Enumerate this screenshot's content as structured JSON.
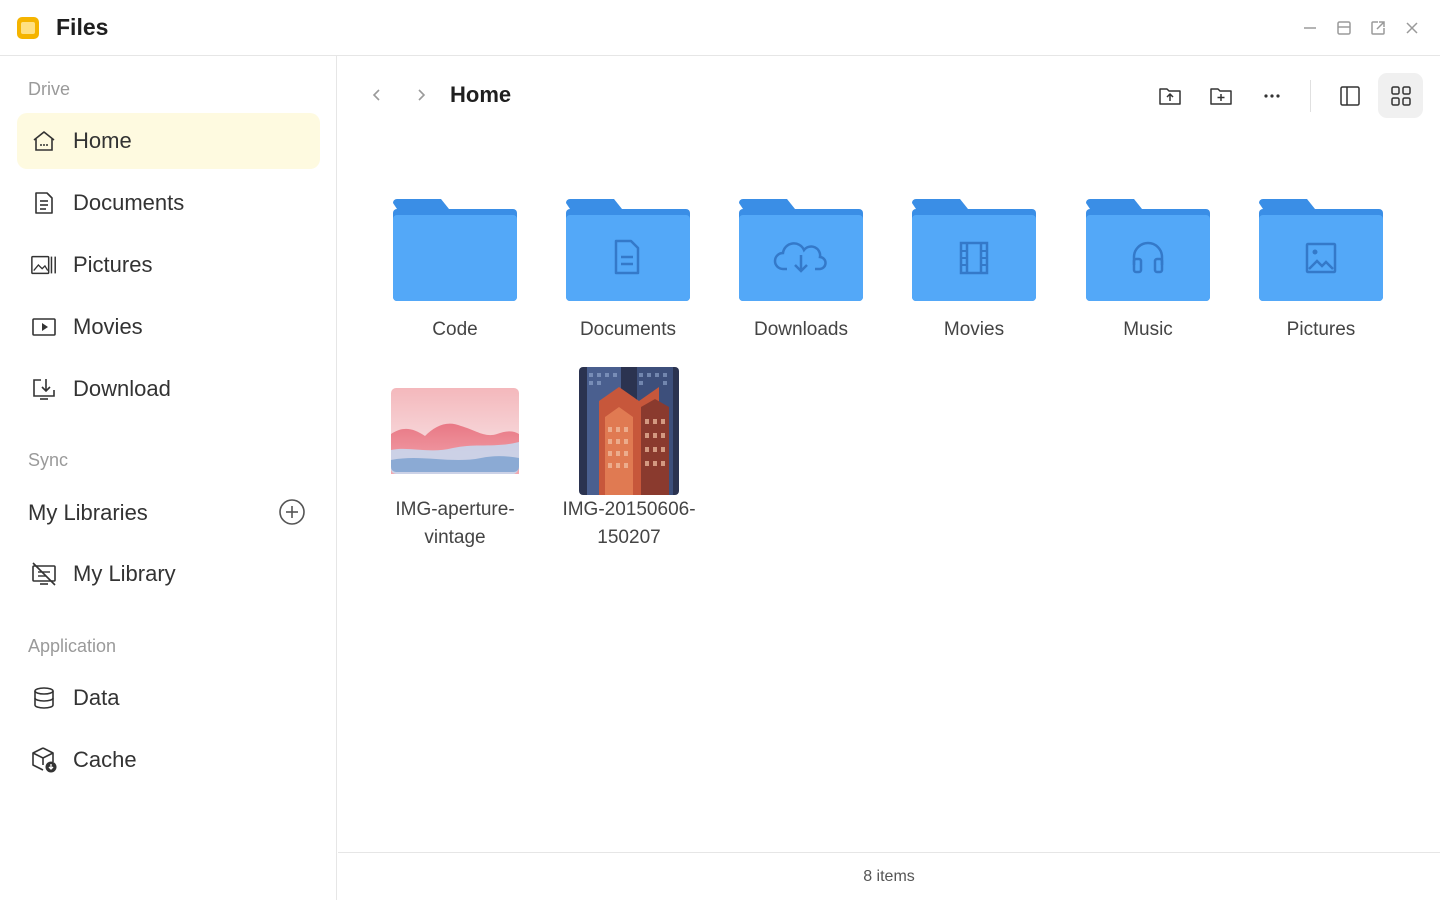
{
  "app": {
    "title": "Files"
  },
  "sidebar": {
    "sections": {
      "drive": "Drive",
      "sync": "Sync",
      "application": "Application"
    },
    "drive_items": [
      {
        "label": "Home",
        "icon": "home-icon",
        "active": true
      },
      {
        "label": "Documents",
        "icon": "document-icon"
      },
      {
        "label": "Pictures",
        "icon": "pictures-icon"
      },
      {
        "label": "Movies",
        "icon": "movie-icon"
      },
      {
        "label": "Download",
        "icon": "download-icon"
      }
    ],
    "sync": {
      "header": "My Libraries",
      "items": [
        {
          "label": "My Library",
          "icon": "library-icon"
        }
      ]
    },
    "application_items": [
      {
        "label": "Data",
        "icon": "database-icon"
      },
      {
        "label": "Cache",
        "icon": "cache-icon"
      }
    ]
  },
  "toolbar": {
    "breadcrumb": "Home"
  },
  "items": [
    {
      "name": "Code",
      "kind": "folder",
      "glyph": "none"
    },
    {
      "name": "Documents",
      "kind": "folder",
      "glyph": "document"
    },
    {
      "name": "Downloads",
      "kind": "folder",
      "glyph": "cloud-download"
    },
    {
      "name": "Movies",
      "kind": "folder",
      "glyph": "film"
    },
    {
      "name": "Music",
      "kind": "folder",
      "glyph": "headphones"
    },
    {
      "name": "Pictures",
      "kind": "folder",
      "glyph": "image"
    },
    {
      "name_line1": "IMG-aperture-",
      "name_line2": "vintage",
      "kind": "image"
    },
    {
      "name_line1": "IMG-20150606-",
      "name_line2": "150207",
      "kind": "image"
    }
  ],
  "status": {
    "count": "8 items"
  },
  "colors": {
    "folder": "#4ea5f7",
    "folder_tab": "#3a8ee6",
    "active_nav": "#fefae0",
    "accent": "#f5b400"
  }
}
